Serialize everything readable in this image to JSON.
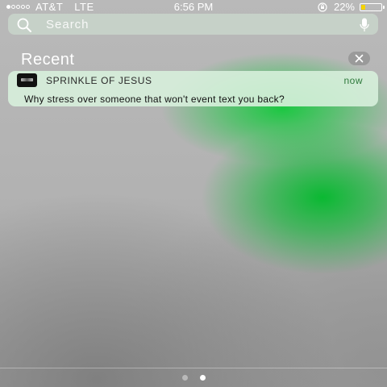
{
  "status_bar": {
    "signal_bars": 1,
    "signal_total": 5,
    "carrier": "AT&T",
    "network": "LTE",
    "time": "6:56 PM",
    "battery_percent_label": "22%",
    "battery_level": 0.22,
    "icons": [
      "signal-dots",
      "rotation-lock-icon",
      "battery-icon"
    ]
  },
  "search": {
    "placeholder": "Search",
    "value": "",
    "icons": [
      "search-icon",
      "microphone-icon"
    ]
  },
  "recent": {
    "title": "Recent",
    "clear_icon": "close-icon"
  },
  "notifications": [
    {
      "app_name": "SPRINKLE OF JESUS",
      "time": "now",
      "message": "Why stress over someone that won't event text you back?"
    }
  ],
  "page_indicator": {
    "pages": 2,
    "current": 2
  },
  "colors": {
    "accent_green": "#14c83c",
    "notification_time": "#2f7a3c",
    "battery": "#f5d300"
  }
}
